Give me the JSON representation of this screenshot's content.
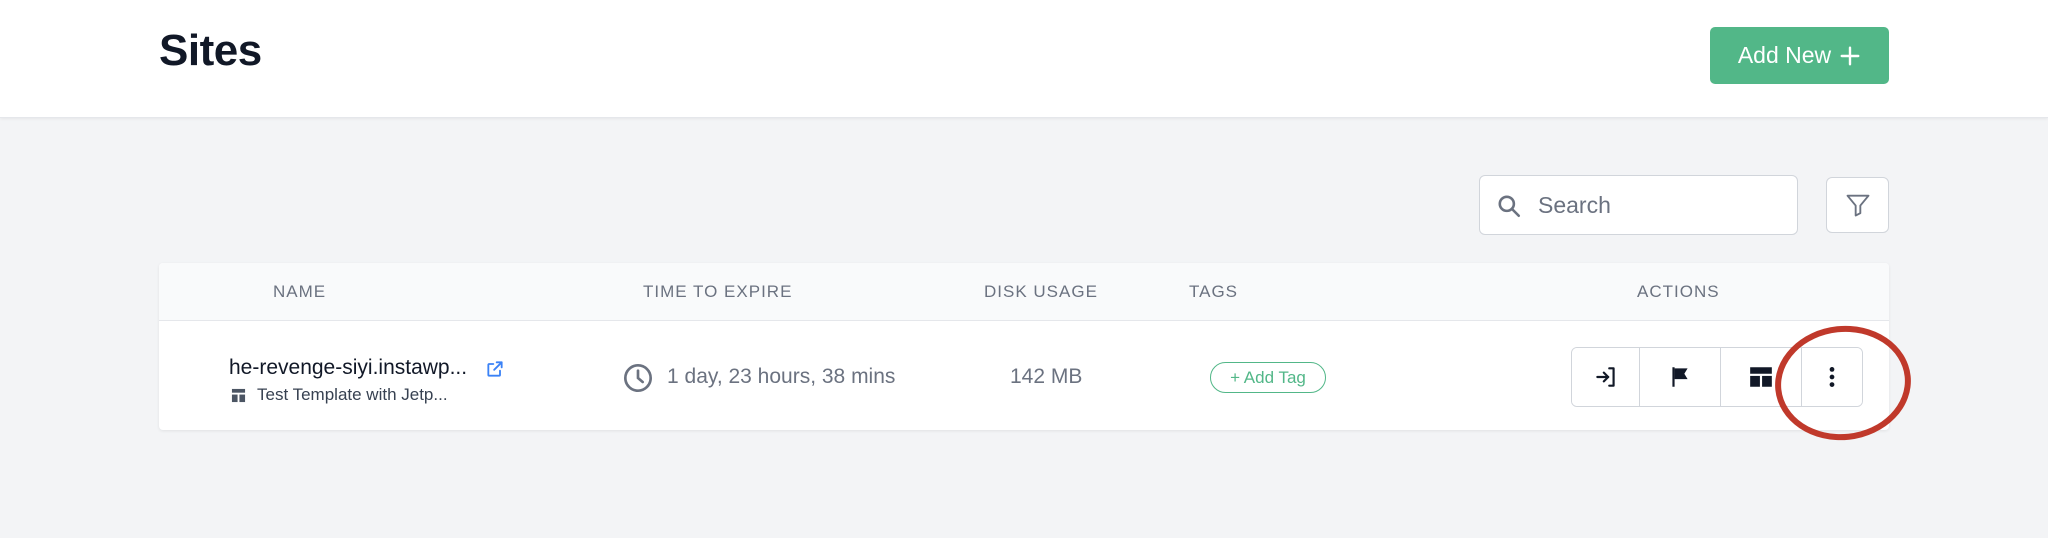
{
  "header": {
    "title": "Sites",
    "add_new_label": "Add New"
  },
  "toolbar": {
    "search_placeholder": "Search",
    "search_value": ""
  },
  "table": {
    "columns": [
      "NAME",
      "TIME TO EXPIRE",
      "DISK USAGE",
      "TAGS",
      "ACTIONS"
    ],
    "rows": [
      {
        "site_name": "he-revenge-siyi.instawp...",
        "template": "Test Template with Jetp...",
        "time_to_expire": "1 day, 23 hours, 38 mins",
        "disk_usage": "142 MB",
        "add_tag_label": "+ Add Tag"
      }
    ]
  },
  "icons": {
    "add": "plus-icon",
    "search": "search-icon",
    "filter": "filter-icon",
    "external_link": "external-link-icon",
    "template": "template-icon",
    "clock": "clock-icon",
    "login": "login-icon",
    "flag": "flag-icon",
    "layout": "layout-icon",
    "more": "more-vertical-icon"
  },
  "colors": {
    "accent": "#52b788",
    "link": "#3b82f6",
    "annotation": "#c0392b",
    "background": "#f3f4f6"
  }
}
